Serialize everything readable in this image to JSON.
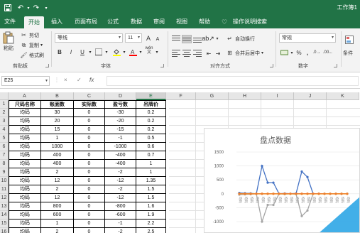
{
  "titlebar": {
    "save_icon": "save-icon",
    "undo_icon": "undo-icon",
    "redo_icon": "redo-icon",
    "customize_icon": "customize-quick-access-icon",
    "doc_title": "工作簿1"
  },
  "tabs": [
    "文件",
    "开始",
    "插入",
    "页面布局",
    "公式",
    "数据",
    "审阅",
    "视图",
    "帮助",
    "操作说明搜索"
  ],
  "active_tab": "开始",
  "ribbon": {
    "clipboard": {
      "paste": "粘贴",
      "cut": "剪切",
      "copy": "复制",
      "format_painter": "格式刷",
      "label": "剪贴板"
    },
    "font": {
      "name": "等线",
      "size": "11",
      "grow": "A",
      "shrink": "A",
      "bold": "B",
      "italic": "I",
      "underline": "U",
      "wen": "wén",
      "label": "字体"
    },
    "alignment": {
      "wrap": "自动换行",
      "merge": "合并后居中",
      "label": "对齐方式"
    },
    "number": {
      "format": "常规",
      "percent": "%",
      "comma": ",",
      "label": "数字"
    },
    "cut_off": "条件"
  },
  "formula_bar": {
    "name_box": "E25",
    "cancel": "×",
    "enter": "✓",
    "fx": "fx",
    "value": ""
  },
  "columns": [
    "A",
    "B",
    "C",
    "D",
    "E",
    "F",
    "G",
    "H",
    "I",
    "J",
    "K"
  ],
  "selected_column": "E",
  "rows": [
    "1",
    "2",
    "3",
    "4",
    "5",
    "6",
    "7",
    "8",
    "9",
    "10",
    "11",
    "12",
    "13",
    "14",
    "15",
    "16"
  ],
  "table": {
    "headers": [
      "尺码名称",
      "账面数",
      "实际数",
      "盈亏数",
      "吊牌价"
    ],
    "data": [
      [
        "均码",
        "30",
        "0",
        "-30",
        "0.2"
      ],
      [
        "均码",
        "20",
        "0",
        "-20",
        "0.2"
      ],
      [
        "均码",
        "15",
        "0",
        "-15",
        "0.2"
      ],
      [
        "均码",
        "1",
        "0",
        "-1",
        "0.5"
      ],
      [
        "均码",
        "1000",
        "0",
        "-1000",
        "0.6"
      ],
      [
        "均码",
        "400",
        "0",
        "-400",
        "0.7"
      ],
      [
        "均码",
        "400",
        "0",
        "-400",
        "1"
      ],
      [
        "均码",
        "2",
        "0",
        "-2",
        "1"
      ],
      [
        "均码",
        "12",
        "0",
        "-12",
        "1.35"
      ],
      [
        "均码",
        "2",
        "0",
        "-2",
        "1.5"
      ],
      [
        "均码",
        "12",
        "0",
        "-12",
        "1.5"
      ],
      [
        "均码",
        "800",
        "0",
        "-800",
        "1.6"
      ],
      [
        "均码",
        "600",
        "0",
        "-600",
        "1.9"
      ],
      [
        "均码",
        "1",
        "0",
        "-1",
        "2.2"
      ],
      [
        "均码",
        "2",
        "0",
        "-2",
        "2.5"
      ]
    ]
  },
  "chart_data": {
    "type": "line",
    "title": "盘点数据",
    "ylim": [
      -1000,
      1500
    ],
    "yticks": [
      "1500",
      "1000",
      "500",
      "0",
      "-500",
      "-1000"
    ],
    "x": [
      "均码",
      "均码",
      "均码",
      "均码",
      "均码",
      "均码",
      "均码",
      "均码",
      "均码",
      "均码",
      "均码",
      "均码",
      "均码",
      "均码",
      "均码",
      "均码",
      "均码",
      "均码",
      "均码",
      "均码"
    ],
    "series": [
      {
        "color": "#4472c4",
        "values": [
          30,
          20,
          15,
          1,
          1000,
          400,
          400,
          2,
          12,
          2,
          12,
          800,
          600,
          1,
          2,
          0,
          0,
          0,
          0,
          0
        ]
      },
      {
        "color": "#a5a5a5",
        "values": [
          -30,
          -20,
          -15,
          -1,
          -1000,
          -400,
          -400,
          -2,
          -12,
          -2,
          -12,
          -800,
          -600,
          -1,
          -2,
          0,
          0,
          0,
          0,
          0
        ]
      },
      {
        "color": "#ffc000",
        "values": [
          0,
          0,
          0,
          0,
          0,
          0,
          0,
          0,
          0,
          0,
          0,
          0,
          0,
          0,
          0,
          0,
          0,
          0,
          0,
          0
        ]
      },
      {
        "color": "#ed7d31",
        "values": [
          0.2,
          0.2,
          0.2,
          0.5,
          0.6,
          0.7,
          1,
          1,
          1.35,
          1.5,
          1.5,
          1.6,
          1.9,
          2.2,
          2.5,
          0,
          0,
          0,
          0,
          0
        ]
      }
    ]
  }
}
